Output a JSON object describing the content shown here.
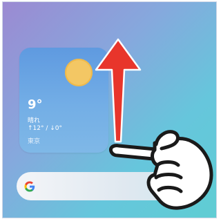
{
  "weather_widget": {
    "temperature": "9°",
    "condition": "晴れ",
    "high_low": "↑12° / ↓0°",
    "location": "東京",
    "icon": "sun-icon"
  },
  "search_bar": {
    "icon": "google-g-icon"
  },
  "overlay": {
    "arrow": "swipe-up-arrow",
    "hand": "pointing-hand",
    "arrow_color": "#e8352b"
  }
}
